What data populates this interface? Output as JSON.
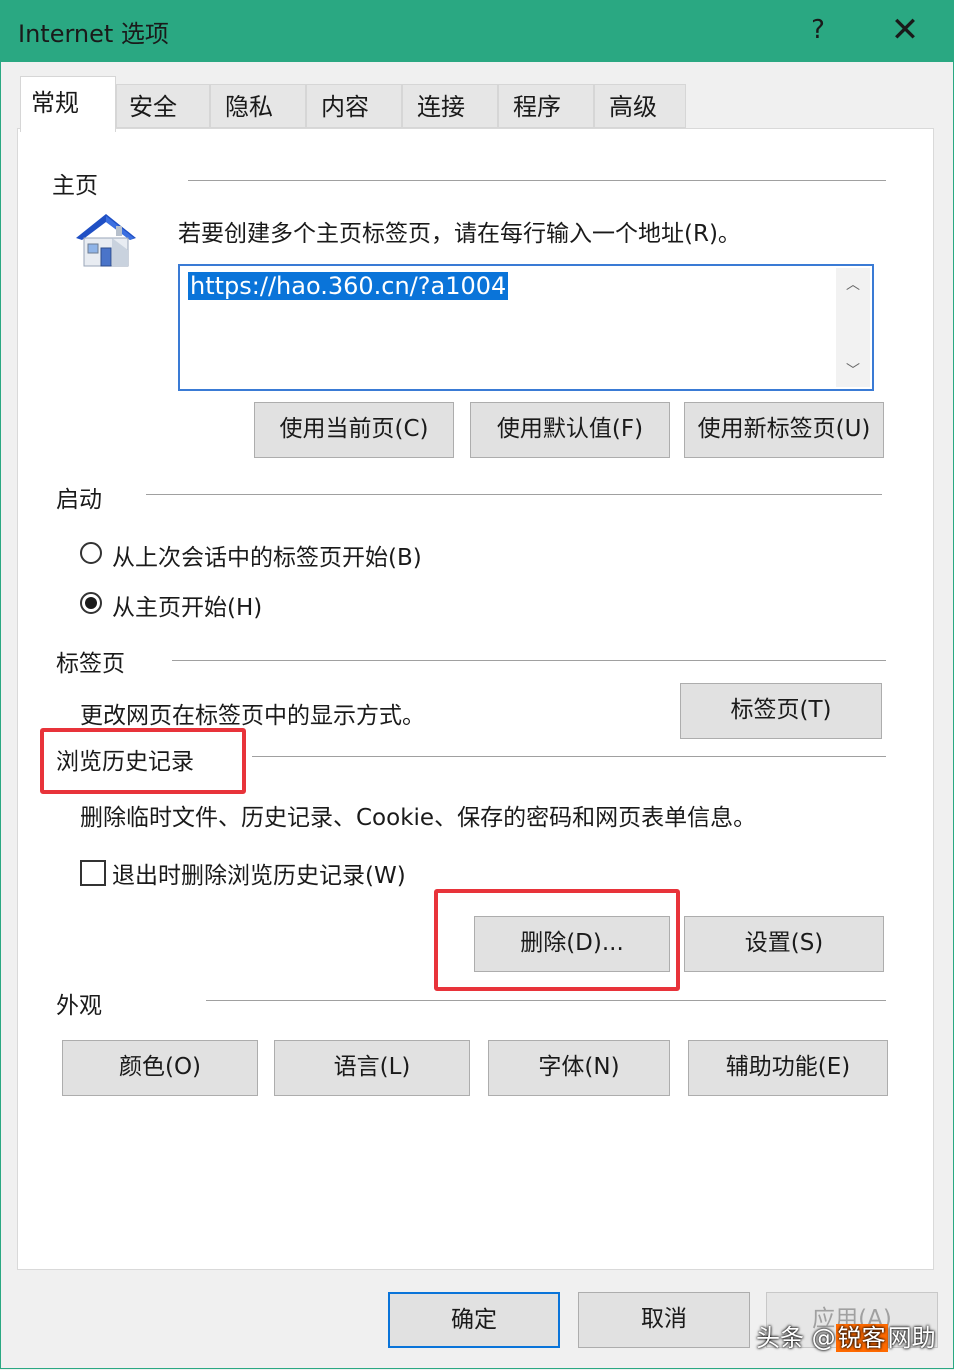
{
  "window": {
    "title": "Internet 选项",
    "help": "?",
    "close": "✕"
  },
  "tabs": [
    {
      "label": "常规",
      "active": true
    },
    {
      "label": "安全"
    },
    {
      "label": "隐私"
    },
    {
      "label": "内容"
    },
    {
      "label": "连接"
    },
    {
      "label": "程序"
    },
    {
      "label": "高级"
    }
  ],
  "homepage": {
    "group_label": "主页",
    "icon": "home-icon",
    "instruction": "若要创建多个主页标签页，请在每行输入一个地址(R)。",
    "url": "https://hao.360.cn/?a1004",
    "buttons": {
      "use_current": "使用当前页(C)",
      "use_default": "使用默认值(F)",
      "use_new_tab": "使用新标签页(U)"
    }
  },
  "startup": {
    "group_label": "启动",
    "option_last_session": "从上次会话中的标签页开始(B)",
    "option_homepage": "从主页开始(H)",
    "selected": "option_homepage"
  },
  "tabs_section": {
    "group_label": "标签页",
    "description": "更改网页在标签页中的显示方式。",
    "button": "标签页(T)"
  },
  "history": {
    "group_label": "浏览历史记录",
    "description": "删除临时文件、历史记录、Cookie、保存的密码和网页表单信息。",
    "checkbox_label": "退出时删除浏览历史记录(W)",
    "checkbox_checked": false,
    "delete_button": "删除(D)...",
    "settings_button": "设置(S)"
  },
  "appearance": {
    "group_label": "外观",
    "buttons": {
      "colors": "颜色(O)",
      "languages": "语言(L)",
      "fonts": "字体(N)",
      "accessibility": "辅助功能(E)"
    }
  },
  "footer": {
    "ok": "确定",
    "cancel": "取消",
    "apply": "应用(A)"
  },
  "watermark": {
    "prefix": "头条 @",
    "highlight": "锐客",
    "suffix": "网助"
  },
  "colors": {
    "titlebar": "#2aa882",
    "selection": "#0a74d9",
    "highlight_box": "#e8333a"
  }
}
